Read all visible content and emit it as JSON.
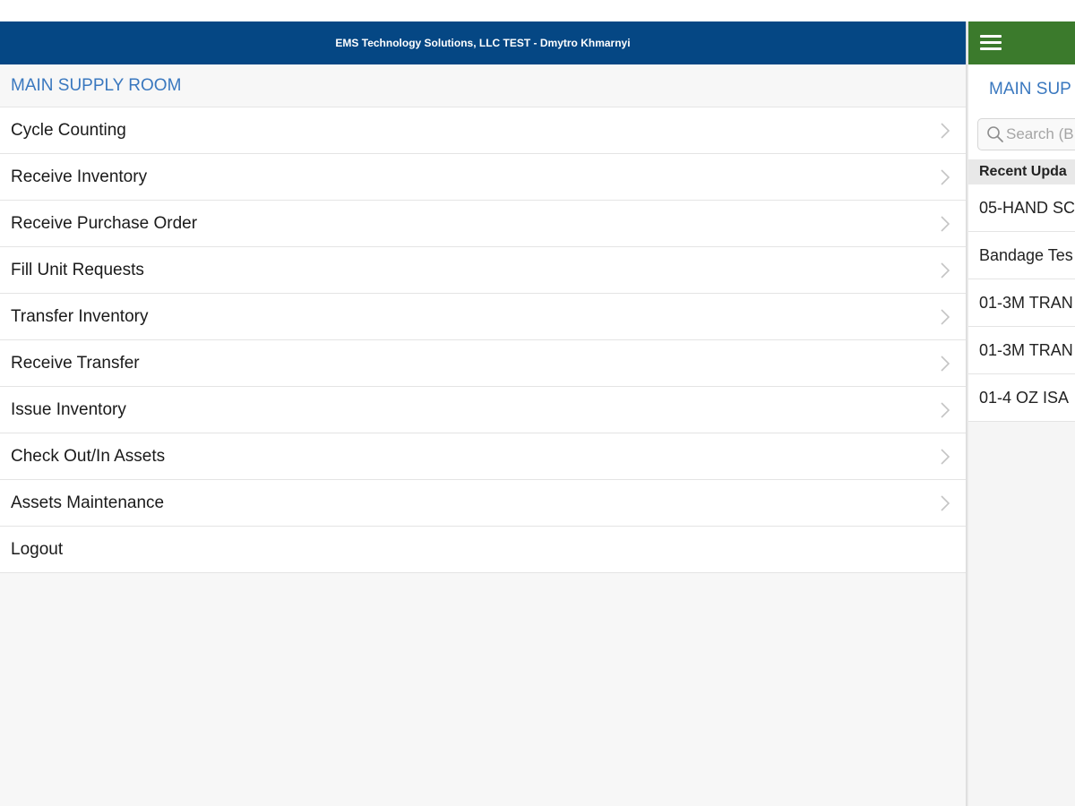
{
  "header": {
    "title": "EMS Technology Solutions, LLC TEST - Dmytro Khmarnyi"
  },
  "menu": {
    "section_title": "MAIN SUPPLY ROOM",
    "items": [
      {
        "label": "Cycle Counting",
        "icon": "chevron-right-icon"
      },
      {
        "label": "Receive Inventory",
        "icon": "chevron-right-icon"
      },
      {
        "label": "Receive Purchase Order",
        "icon": "chevron-right-icon"
      },
      {
        "label": "Fill Unit Requests",
        "icon": "chevron-right-icon"
      },
      {
        "label": "Transfer Inventory",
        "icon": "chevron-right-icon"
      },
      {
        "label": "Receive Transfer",
        "icon": "chevron-right-icon"
      },
      {
        "label": "Issue Inventory",
        "icon": "chevron-right-icon"
      },
      {
        "label": "Check Out/In Assets",
        "icon": "chevron-right-icon"
      },
      {
        "label": "Assets Maintenance",
        "icon": "chevron-right-icon"
      },
      {
        "label": "Logout"
      }
    ]
  },
  "right_panel": {
    "menu_icon": "hamburger-menu-icon",
    "title": "MAIN SUP",
    "search": {
      "placeholder": "Search (B",
      "icon": "search-icon"
    },
    "recent_header": "Recent Upda",
    "recent_items": [
      "05-HAND SC",
      "Bandage Tes",
      "01-3M TRAN",
      "01-3M TRAN",
      "01-4 OZ ISA"
    ]
  },
  "colors": {
    "left_header_bg": "#054784",
    "right_header_bg": "#3b7a2c",
    "section_title_color": "#3a78bf"
  }
}
